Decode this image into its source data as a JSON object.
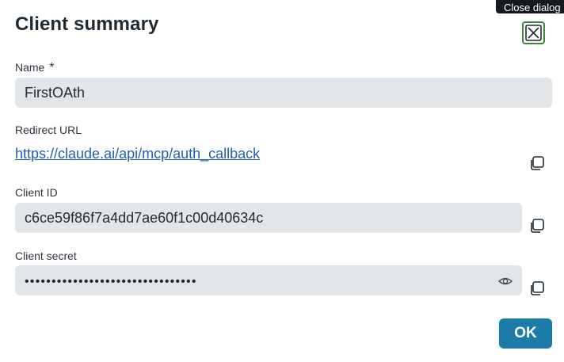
{
  "tooltip": {
    "text": "Close dialog"
  },
  "dialog": {
    "title": "Client summary",
    "close_icon": "close-x-icon",
    "ok_label": "OK"
  },
  "fields": {
    "name": {
      "label": "Name",
      "required_mark": "*",
      "value": "FirstOAth"
    },
    "redirect_url": {
      "label": "Redirect URL",
      "value": "https://claude.ai/api/mcp/auth_callback"
    },
    "client_id": {
      "label": "Client ID",
      "value": "c6ce59f86f7a4dd7ae60f1c00d40634c"
    },
    "client_secret": {
      "label": "Client secret",
      "masked_value": "••••••••••••••••••••••••••••••••"
    }
  },
  "icons": {
    "copy": "copy-icon",
    "eye": "eye-icon"
  },
  "colors": {
    "primary": "#1b7ca8",
    "close_border": "#3a8a3a",
    "link": "#1d5fb3",
    "field_bg": "#e3e6e8"
  }
}
